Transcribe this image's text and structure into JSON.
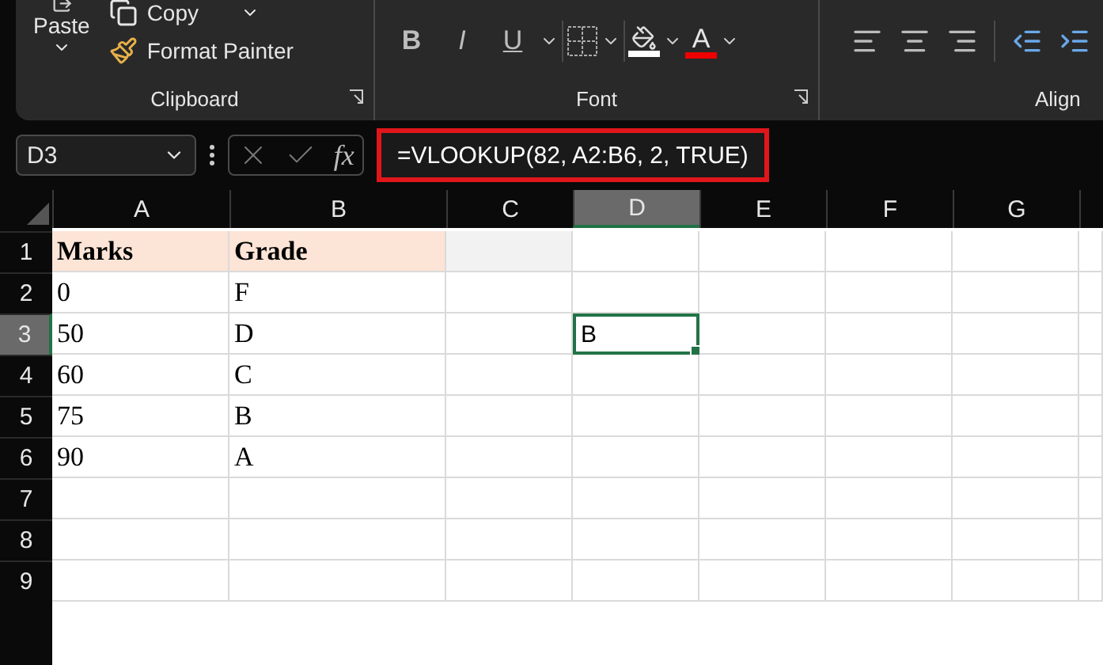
{
  "ribbon": {
    "groups": [
      {
        "kind": "clipboard",
        "label": "Clipboard",
        "paste": "Paste",
        "copy": "Copy",
        "format_painter": "Format Painter"
      },
      {
        "kind": "font",
        "label": "Font",
        "bold": "B",
        "italic": "I",
        "underline": "U",
        "font_color": "A"
      },
      {
        "kind": "alignment",
        "label": "Align"
      }
    ]
  },
  "formula_bar": {
    "name_box": "D3",
    "fx": "fx",
    "formula": "=VLOOKUP(82, A2:B6, 2, TRUE)",
    "highlighted": true
  },
  "sheet": {
    "columns": [
      {
        "label": "A",
        "selected": false
      },
      {
        "label": "B",
        "selected": false
      },
      {
        "label": "C",
        "selected": false
      },
      {
        "label": "D",
        "selected": true
      },
      {
        "label": "E",
        "selected": false
      },
      {
        "label": "F",
        "selected": false
      },
      {
        "label": "G",
        "selected": false
      }
    ],
    "rows": [
      {
        "label": "1",
        "kind": "header",
        "selected": false,
        "cells": [
          "Marks",
          "Grade"
        ]
      },
      {
        "label": "2",
        "kind": "data",
        "selected": false,
        "cells": [
          "0",
          "F"
        ]
      },
      {
        "label": "3",
        "kind": "data",
        "selected": true,
        "cells": [
          "50",
          "D"
        ]
      },
      {
        "label": "4",
        "kind": "data",
        "selected": false,
        "cells": [
          "60",
          "C"
        ]
      },
      {
        "label": "5",
        "kind": "data",
        "selected": false,
        "cells": [
          "75",
          "B"
        ]
      },
      {
        "label": "6",
        "kind": "data",
        "selected": false,
        "cells": [
          "90",
          "A"
        ]
      },
      {
        "label": "7",
        "kind": "data",
        "selected": false,
        "cells": []
      },
      {
        "label": "8",
        "kind": "data",
        "selected": false,
        "cells": []
      },
      {
        "label": "9",
        "kind": "data",
        "selected": false,
        "cells": []
      }
    ],
    "active_cell": {
      "value": "B"
    }
  }
}
